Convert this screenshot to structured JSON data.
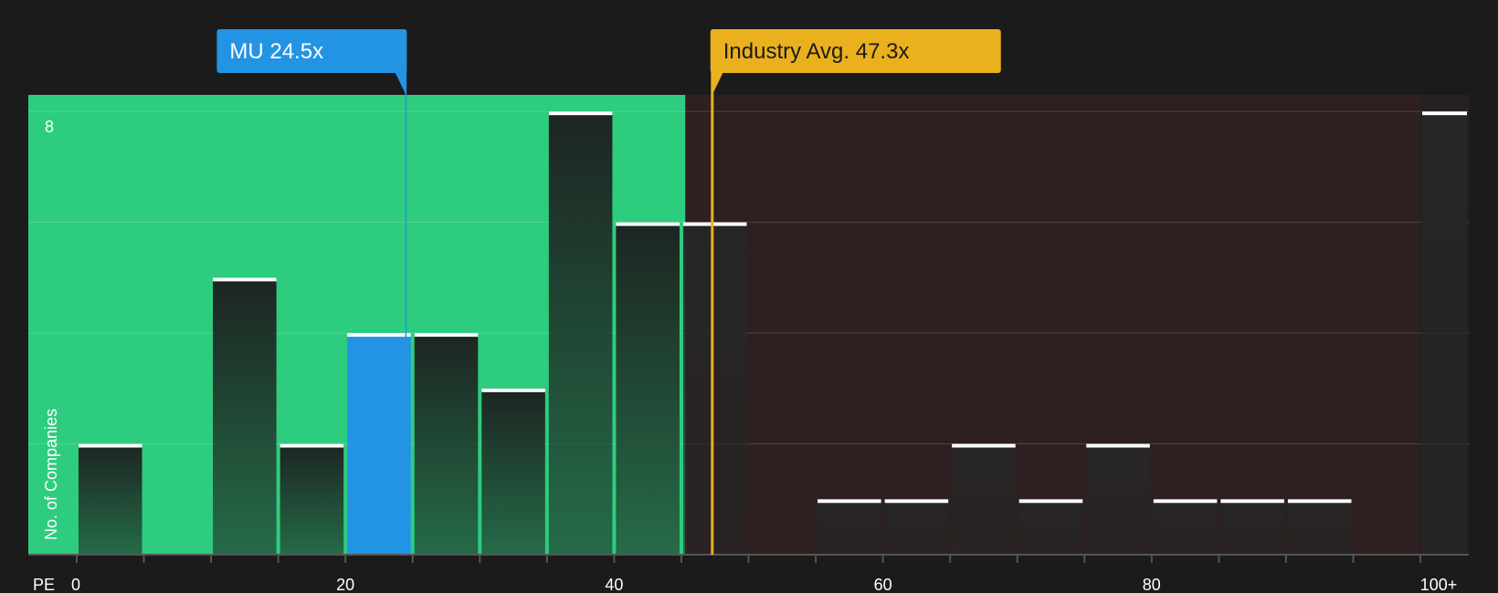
{
  "chart_data": {
    "type": "bar",
    "x_axis_label": "PE",
    "y_axis_label": "No. of Companies",
    "x_ticks": [
      {
        "value": 0,
        "label": "0"
      },
      {
        "value": 20,
        "label": "20"
      },
      {
        "value": 40,
        "label": "40"
      },
      {
        "value": 60,
        "label": "60"
      },
      {
        "value": 80,
        "label": "80"
      },
      {
        "value": 100,
        "label": "100+"
      }
    ],
    "y_tick_labels": [
      {
        "value": 8,
        "label": "8"
      }
    ],
    "xlim": [
      -3.6,
      103.6
    ],
    "ylim": [
      0,
      8.3
    ],
    "bin_width": 5,
    "bins": [
      {
        "start": 0,
        "end": 5,
        "count": 2
      },
      {
        "start": 5,
        "end": 10,
        "count": 0
      },
      {
        "start": 10,
        "end": 15,
        "count": 5
      },
      {
        "start": 15,
        "end": 20,
        "count": 2
      },
      {
        "start": 20,
        "end": 25,
        "count": 4,
        "highlight": true
      },
      {
        "start": 25,
        "end": 30,
        "count": 4
      },
      {
        "start": 30,
        "end": 35,
        "count": 3
      },
      {
        "start": 35,
        "end": 40,
        "count": 8
      },
      {
        "start": 40,
        "end": 45,
        "count": 6
      },
      {
        "start": 45,
        "end": 50,
        "count": 6
      },
      {
        "start": 50,
        "end": 55,
        "count": 0
      },
      {
        "start": 55,
        "end": 60,
        "count": 1
      },
      {
        "start": 60,
        "end": 65,
        "count": 1
      },
      {
        "start": 65,
        "end": 70,
        "count": 2
      },
      {
        "start": 70,
        "end": 75,
        "count": 1
      },
      {
        "start": 75,
        "end": 80,
        "count": 2
      },
      {
        "start": 80,
        "end": 85,
        "count": 1
      },
      {
        "start": 85,
        "end": 90,
        "count": 1
      },
      {
        "start": 90,
        "end": 95,
        "count": 1
      },
      {
        "start": 95,
        "end": 100,
        "count": 0
      },
      {
        "start": 100,
        "end": 103.6,
        "count": 8
      }
    ],
    "shaded_regions": [
      {
        "from": -3.6,
        "to": 45.3,
        "color": "#2ecc7f",
        "meaning": "below fair"
      },
      {
        "from": 45.3,
        "to": 103.6,
        "color": "#2e1f20",
        "meaning": "above fair"
      }
    ],
    "markers": [
      {
        "name": "MU",
        "value": 24.5,
        "label": "MU 24.5x",
        "color": "#2394e3",
        "text_color": "#ffffff"
      },
      {
        "name": "Industry Avg.",
        "value": 47.3,
        "label": "Industry Avg. 47.3x",
        "color": "#eab01e",
        "text_color": "#1b1b1b"
      }
    ],
    "gridlines": [
      2,
      4,
      6,
      8
    ],
    "grid": true,
    "legend": "none"
  },
  "colors": {
    "background": "#1b1b1b",
    "bar_default": "#262626",
    "bar_highlight": "#2394e3",
    "bar_cap": "#ffffff",
    "axis": "#555555"
  }
}
